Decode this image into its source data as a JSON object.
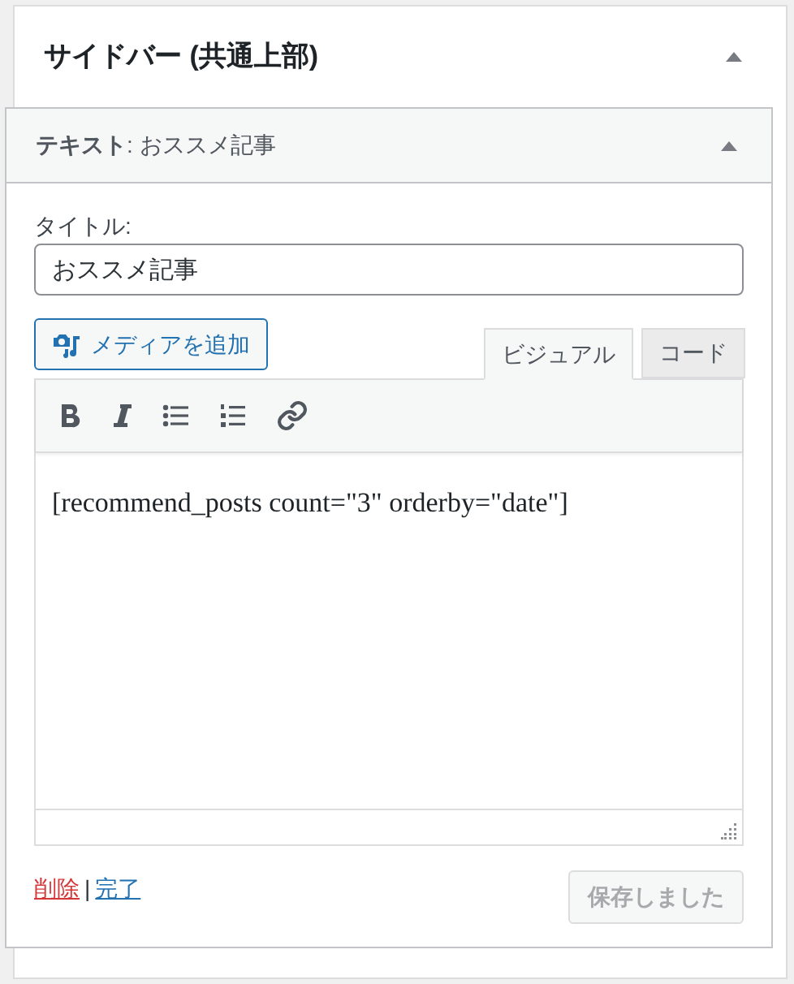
{
  "area": {
    "title": "サイドバー (共通上部)",
    "expanded": true
  },
  "widget": {
    "title": "**テキスト**: おススメ記事",
    "expanded": true
  },
  "title_field": {
    "label": "タイトル:",
    "value": "おススメ記事"
  },
  "media_button": "メディアを追加",
  "tabs": [
    {
      "label": "ビジュアル",
      "selected": true
    },
    {
      "label": "コード",
      "selected": false
    }
  ],
  "toolbar": [
    {
      "kind": "bold"
    },
    {
      "kind": "italic"
    },
    {
      "kind": "bullets"
    },
    {
      "kind": "numbers"
    },
    {
      "kind": "link"
    }
  ],
  "content": "[recommend_posts count=\"3\" orderby=\"date\"]",
  "actions": {
    "delete": "削除",
    "separator": "|",
    "done": "完了"
  },
  "save_button": {
    "label": "保存しました",
    "disabled": true
  }
}
